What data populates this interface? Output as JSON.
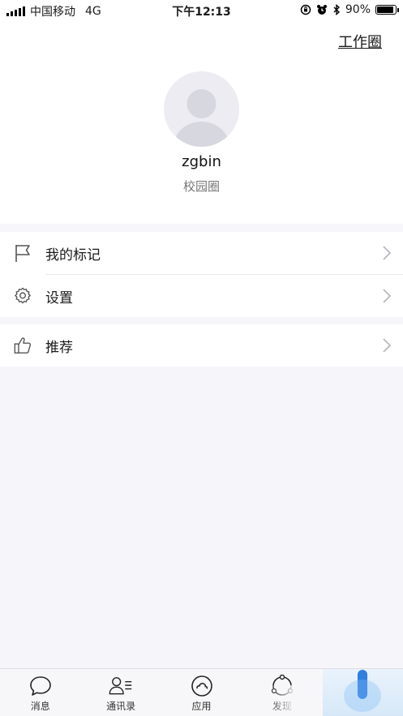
{
  "status_bar": {
    "carrier": "中国移动",
    "network": "4G",
    "time": "下午12:13",
    "battery": "90%",
    "battery_level": 0.9
  },
  "header": {
    "work_circle": "工作圈",
    "username": "zgbin",
    "subtitle": "校园圈"
  },
  "menu": {
    "items": [
      {
        "label": "我的标记",
        "icon": "flag-icon"
      },
      {
        "label": "设置",
        "icon": "gear-icon"
      },
      {
        "label": "推荐",
        "icon": "thumbs-up-icon"
      }
    ]
  },
  "tabbar": {
    "tabs": [
      {
        "label": "消息",
        "icon": "chat-bubble-icon"
      },
      {
        "label": "通讯录",
        "icon": "contacts-icon"
      },
      {
        "label": "应用",
        "icon": "cloud-circle-icon"
      },
      {
        "label": "发现",
        "icon": "discover-icon"
      },
      {
        "label": "",
        "icon": "me-icon"
      }
    ]
  },
  "colors": {
    "accent": "#2f7fe0",
    "background": "#f6f6fa"
  }
}
